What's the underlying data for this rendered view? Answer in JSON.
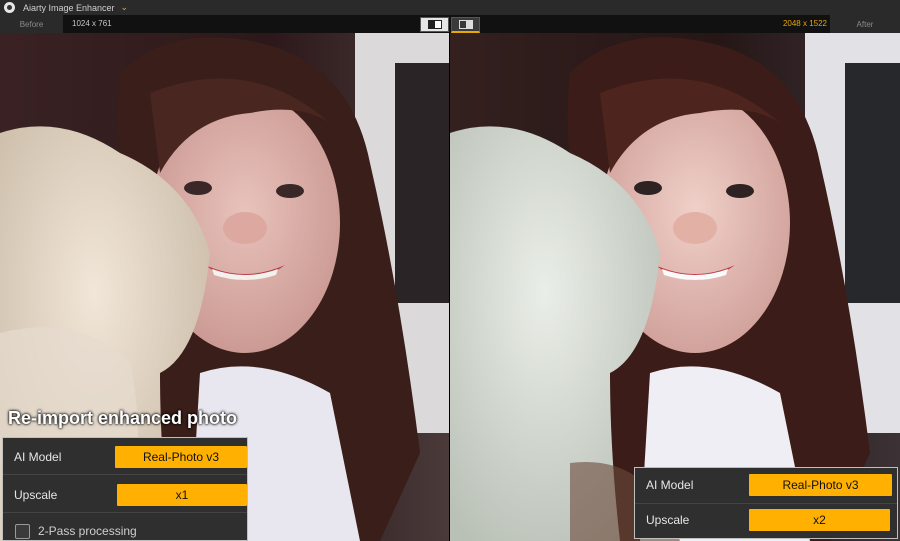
{
  "app": {
    "title": "Aiarty Image Enhancer"
  },
  "header": {
    "before_label": "Before",
    "after_label": "After",
    "before_dims": "1024 x 761",
    "after_dims": "2048 x 1522"
  },
  "caption": "Re-import enhanced photo",
  "left_panel": {
    "model_label": "AI Model",
    "model_value": "Real-Photo  v3",
    "upscale_label": "Upscale",
    "upscale_value": "x1",
    "two_pass_label": "2-Pass processing",
    "two_pass_checked": false
  },
  "right_panel": {
    "model_label": "AI Model",
    "model_value": "Real-Photo  v3",
    "upscale_label": "Upscale",
    "upscale_value": "x2"
  },
  "colors": {
    "accent": "#ffb000",
    "panel_bg": "#2f2f2f",
    "dims_after": "#e8a800"
  },
  "icons": [
    "app-logo-icon",
    "chevron-down-icon",
    "split-view-icon",
    "side-by-side-icon"
  ]
}
